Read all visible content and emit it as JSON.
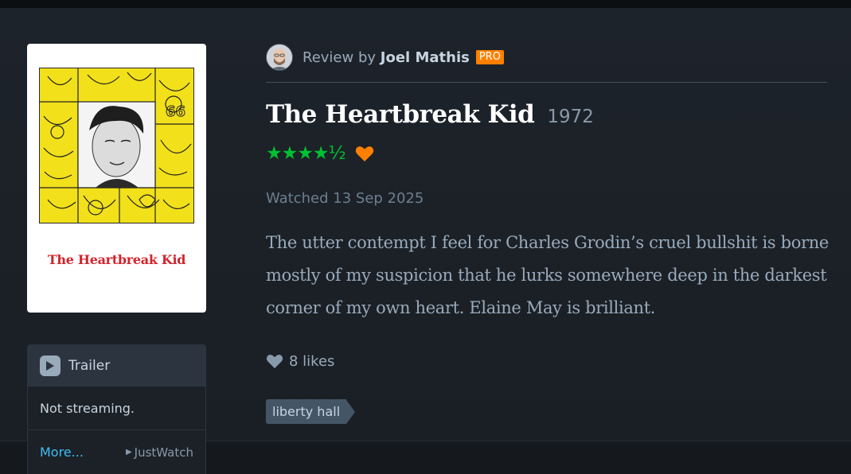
{
  "review": {
    "prefix": "Review by",
    "reviewer": "Joel Mathis",
    "badge": "PRO",
    "film_title": "The Heartbreak Kid",
    "year": "1972",
    "stars": "★★★★½",
    "liked": true,
    "watched": "Watched 13 Sep 2025",
    "text": "The utter contempt I feel for Charles Grodin’s cruel bullshit is borne mostly of my suspicion that he lurks somewhere deep in the darkest corner of my own heart. Elaine May is brilliant.",
    "likes": "8 likes",
    "tag": "liberty hall"
  },
  "poster": {
    "title": "The Heartbreak Kid"
  },
  "panel": {
    "trailer_label": "Trailer",
    "streaming": "Not streaming.",
    "more": "More...",
    "provider": "JustWatch"
  },
  "colors": {
    "star_green": "#00c030",
    "heart_orange": "#ff8000",
    "pro_orange": "#ff8000",
    "link_blue": "#40bcf4",
    "background": "#14181c"
  },
  "icons": {
    "play": "play-icon",
    "heart": "heart-icon",
    "like": "like-heart-icon",
    "justwatch": "justwatch-icon"
  }
}
